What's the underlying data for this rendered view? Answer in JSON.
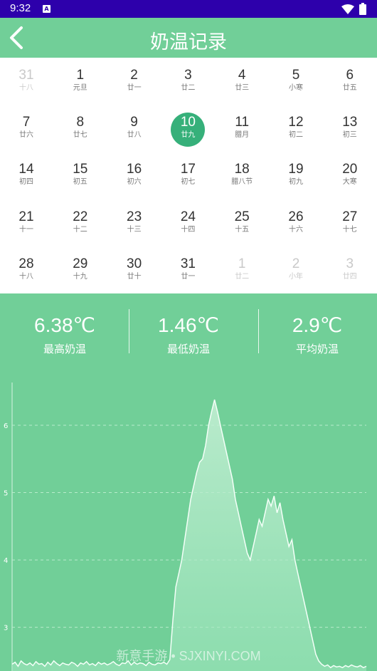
{
  "status": {
    "time": "9:32",
    "notif_glyph": "A"
  },
  "header": {
    "title": "奶温记录"
  },
  "calendar": {
    "rows": [
      [
        {
          "n": "31",
          "l": "十八",
          "other": true
        },
        {
          "n": "1",
          "l": "元旦"
        },
        {
          "n": "2",
          "l": "廿一"
        },
        {
          "n": "3",
          "l": "廿二"
        },
        {
          "n": "4",
          "l": "廿三"
        },
        {
          "n": "5",
          "l": "小寒"
        },
        {
          "n": "6",
          "l": "廿五"
        }
      ],
      [
        {
          "n": "7",
          "l": "廿六"
        },
        {
          "n": "8",
          "l": "廿七"
        },
        {
          "n": "9",
          "l": "廿八"
        },
        {
          "n": "10",
          "l": "廿九",
          "selected": true
        },
        {
          "n": "11",
          "l": "腊月"
        },
        {
          "n": "12",
          "l": "初二"
        },
        {
          "n": "13",
          "l": "初三"
        }
      ],
      [
        {
          "n": "14",
          "l": "初四"
        },
        {
          "n": "15",
          "l": "初五"
        },
        {
          "n": "16",
          "l": "初六"
        },
        {
          "n": "17",
          "l": "初七"
        },
        {
          "n": "18",
          "l": "腊八节"
        },
        {
          "n": "19",
          "l": "初九"
        },
        {
          "n": "20",
          "l": "大寒"
        }
      ],
      [
        {
          "n": "21",
          "l": "十一"
        },
        {
          "n": "22",
          "l": "十二"
        },
        {
          "n": "23",
          "l": "十三"
        },
        {
          "n": "24",
          "l": "十四"
        },
        {
          "n": "25",
          "l": "十五"
        },
        {
          "n": "26",
          "l": "十六"
        },
        {
          "n": "27",
          "l": "十七"
        }
      ],
      [
        {
          "n": "28",
          "l": "十八"
        },
        {
          "n": "29",
          "l": "十九"
        },
        {
          "n": "30",
          "l": "廿十"
        },
        {
          "n": "31",
          "l": "廿一"
        },
        {
          "n": "1",
          "l": "廿二",
          "other": true
        },
        {
          "n": "2",
          "l": "小年",
          "other": true
        },
        {
          "n": "3",
          "l": "廿四",
          "other": true
        }
      ]
    ]
  },
  "stats": {
    "max": {
      "value": "6.38℃",
      "label": "最高奶温"
    },
    "min": {
      "value": "1.46℃",
      "label": "最低奶温"
    },
    "avg": {
      "value": "2.9℃",
      "label": "平均奶温"
    }
  },
  "chart_data": {
    "type": "area",
    "ylim": [
      2.35,
      6.9
    ],
    "y_ticks": [
      "6",
      "5",
      "4",
      "3"
    ],
    "grid": true,
    "values": [
      2.45,
      2.48,
      2.42,
      2.5,
      2.46,
      2.44,
      2.47,
      2.43,
      2.49,
      2.45,
      2.46,
      2.42,
      2.48,
      2.44,
      2.5,
      2.46,
      2.43,
      2.47,
      2.45,
      2.44,
      2.48,
      2.46,
      2.42,
      2.47,
      2.45,
      2.49,
      2.44,
      2.46,
      2.43,
      2.48,
      2.45,
      2.47,
      2.44,
      2.46,
      2.49,
      2.45,
      2.43,
      2.47,
      2.46,
      2.5,
      2.44,
      2.48,
      2.45,
      2.47,
      2.46,
      2.43,
      2.48,
      2.45,
      2.44,
      2.47,
      2.46,
      2.48,
      2.45,
      2.52,
      3.1,
      3.6,
      3.8,
      4.0,
      4.3,
      4.6,
      4.9,
      5.1,
      5.3,
      5.45,
      5.5,
      5.7,
      6.0,
      6.2,
      6.38,
      6.2,
      6.0,
      5.8,
      5.6,
      5.4,
      5.2,
      4.9,
      4.7,
      4.5,
      4.3,
      4.1,
      4.0,
      4.2,
      4.4,
      4.6,
      4.5,
      4.7,
      4.9,
      4.8,
      4.95,
      4.7,
      4.85,
      4.6,
      4.4,
      4.2,
      4.3,
      4.0,
      3.8,
      3.6,
      3.4,
      3.2,
      3.0,
      2.8,
      2.6,
      2.5,
      2.45,
      2.42,
      2.44,
      2.4,
      2.43,
      2.41,
      2.42,
      2.4,
      2.43,
      2.41,
      2.44,
      2.42,
      2.41,
      2.43,
      2.4,
      2.42
    ]
  },
  "watermark": "新意手游 • SJXINYI.COM",
  "colors": {
    "statusbar": "#2d00ab",
    "header": "#71cf98",
    "selected_day": "#36b07a"
  },
  "icons": {
    "back": "chevron-left-icon",
    "wifi": "wifi-icon",
    "battery": "battery-icon"
  }
}
